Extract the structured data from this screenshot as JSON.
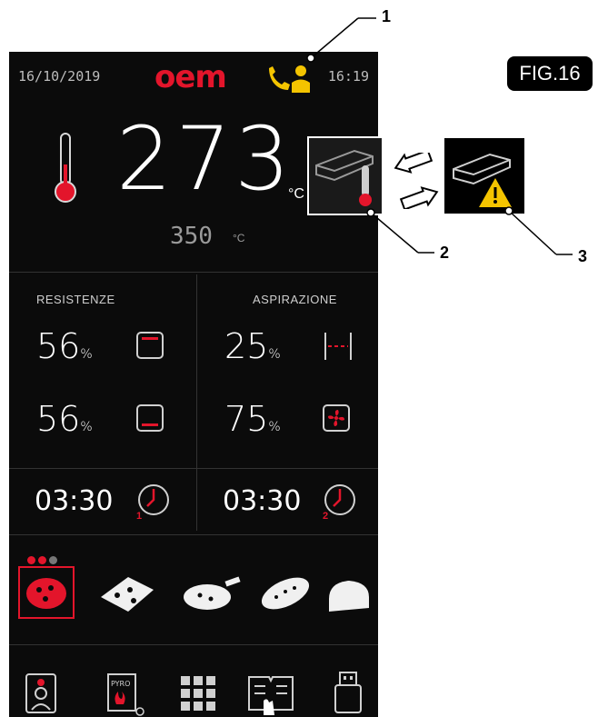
{
  "status": {
    "date": "16/10/2019",
    "brand": "oem",
    "time": "16:19"
  },
  "temperature": {
    "current": "273",
    "unit": "°C",
    "setpoint": "350",
    "setpoint_unit": "°C"
  },
  "resistenze": {
    "title": "RESISTENZE",
    "top_pct": "56",
    "bottom_pct": "56",
    "pct_symbol": "%"
  },
  "aspirazione": {
    "title": "ASPIRAZIONE",
    "top_pct": "25",
    "bottom_pct": "75",
    "pct_symbol": "%"
  },
  "timers": [
    {
      "value": "03:30",
      "index": "1"
    },
    {
      "value": "03:30",
      "index": "2"
    }
  ],
  "products": [
    "pizza-round-icon",
    "pizza-slices-icon",
    "pizza-tray-icon",
    "focaccia-icon",
    "bread-loaf-icon"
  ],
  "bottom_bar": [
    "chef-icon",
    "pyro-icon",
    "grid-menu-icon",
    "recipe-book-icon",
    "usb-icon"
  ],
  "annotations": {
    "one": "1",
    "two": "2",
    "three": "3",
    "fig": "FIG.16"
  },
  "colors": {
    "accent": "#e3152b",
    "service": "#f4c400",
    "background": "#0b0b0b"
  }
}
